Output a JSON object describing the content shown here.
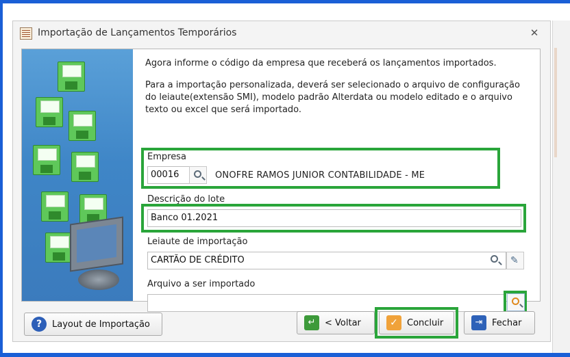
{
  "window": {
    "title": "Importação de Lançamentos Temporários",
    "close_glyph": "✕"
  },
  "intro": {
    "line1": "Agora informe o código da empresa que receberá os lançamentos importados.",
    "line2": "Para a importação personalizada, deverá ser selecionado o arquivo de configuração do leiaute(extensão SMI), modelo padrão Alterdata ou modelo editado e o arquivo texto ou excel que será importado."
  },
  "empresa": {
    "label": "Empresa",
    "code": "00016",
    "name": "ONOFRE RAMOS JUNIOR CONTABILIDADE - ME",
    "search_icon": "search-icon"
  },
  "descricao": {
    "label": "Descrição do lote",
    "value": "Banco 01.2021"
  },
  "leiaute": {
    "label": "Leiaute de importação",
    "value": "CARTÃO DE CRÉDITO",
    "search_icon": "search-icon",
    "edit_icon": "edit-icon"
  },
  "arquivo": {
    "label": "Arquivo a ser importado",
    "value": "",
    "browse_icon": "search-icon"
  },
  "buttons": {
    "layout": "Layout de Importação",
    "voltar": "< Voltar",
    "concluir": "Concluir",
    "fechar": "Fechar"
  },
  "colors": {
    "highlight": "#2aa53a",
    "frame": "#1a5fd6"
  }
}
